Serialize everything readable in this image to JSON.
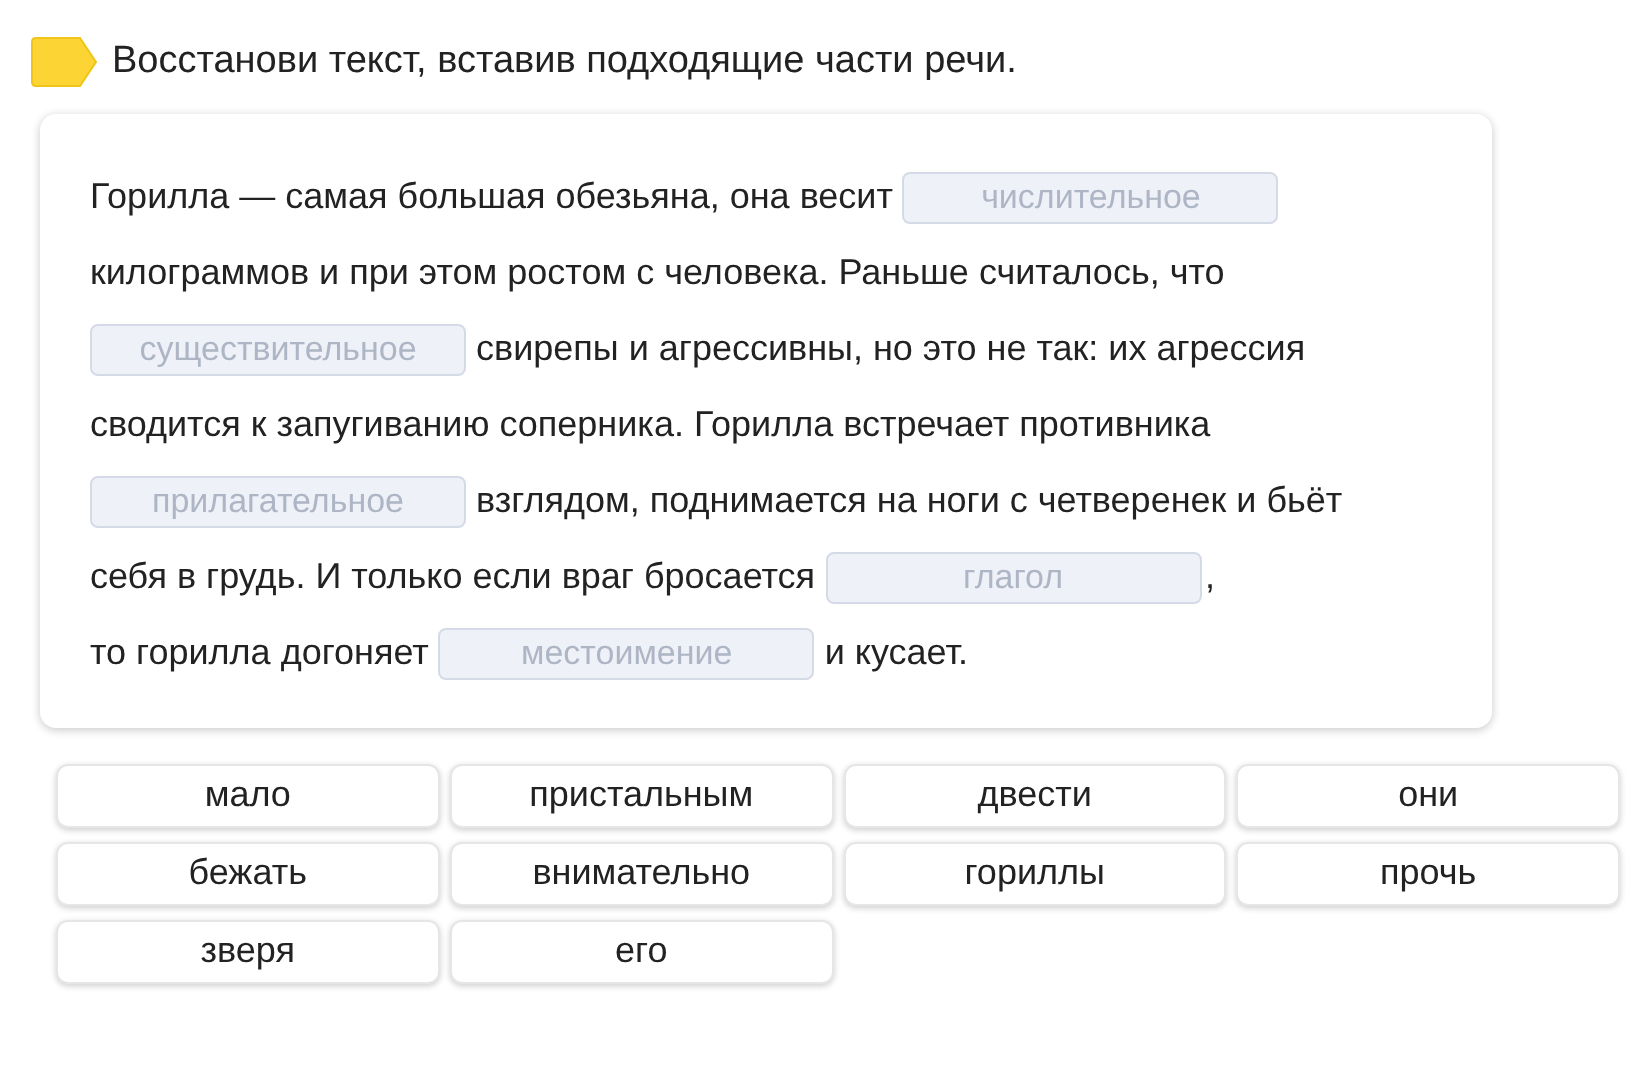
{
  "task": {
    "title": "Восстанови текст, вставив подходящие части речи."
  },
  "text_lines": [
    {
      "parts": [
        {
          "kind": "text",
          "text": "Горилла — самая большая обезьяна, она весит"
        },
        {
          "kind": "blank",
          "placeholder": "числительное"
        }
      ]
    },
    {
      "parts": [
        {
          "kind": "text",
          "text": "килограммов и при этом ростом с человека. Раньше считалось, что"
        }
      ]
    },
    {
      "parts": [
        {
          "kind": "blank",
          "placeholder": "существительное"
        },
        {
          "kind": "text",
          "text": "свирепы и агрессивны, но это не так: их агрессия"
        }
      ]
    },
    {
      "parts": [
        {
          "kind": "text",
          "text": "сводится к запугиванию соперника. Горилла встречает противника"
        }
      ]
    },
    {
      "parts": [
        {
          "kind": "blank",
          "placeholder": "прилагательное"
        },
        {
          "kind": "text",
          "text": "взглядом, поднимается на ноги с четверенек и бьёт"
        }
      ]
    },
    {
      "parts": [
        {
          "kind": "text",
          "text": "себя в грудь. И только если враг бросается"
        },
        {
          "kind": "blank",
          "placeholder": "глагол"
        },
        {
          "kind": "text",
          "text": ","
        }
      ]
    },
    {
      "parts": [
        {
          "kind": "text",
          "text": "то горилла догоняет"
        },
        {
          "kind": "blank",
          "placeholder": "местоимение"
        },
        {
          "kind": "text",
          "text": "и кусает."
        }
      ]
    }
  ],
  "word_options": [
    "мало",
    "пристальным",
    "двести",
    "они",
    "бежать",
    "внимательно",
    "гориллы",
    "прочь",
    "зверя",
    "его"
  ]
}
